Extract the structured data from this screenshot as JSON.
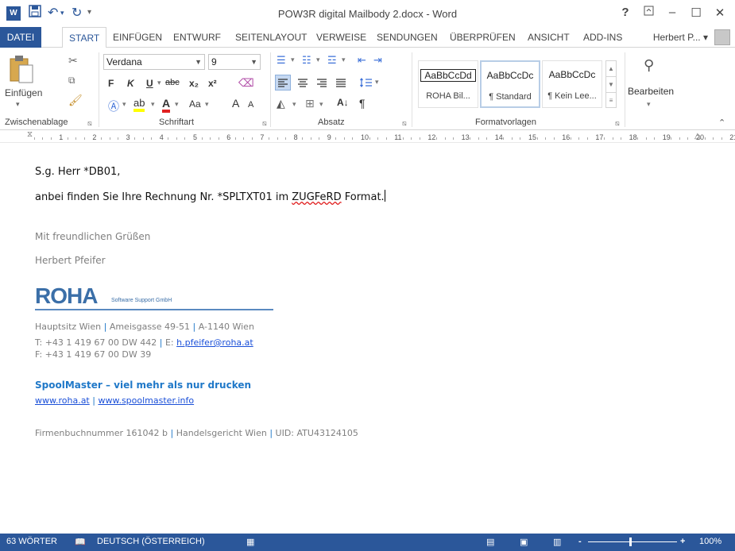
{
  "window": {
    "title": "POW3R digital Mailbody 2.docx - Word",
    "help": "?",
    "app_icon_letter": "W"
  },
  "tabs": {
    "file": "DATEI",
    "items": [
      "START",
      "EINFÜGEN",
      "ENTWURF",
      "SEITENLAYOUT",
      "VERWEISE",
      "SENDUNGEN",
      "ÜBERPRÜFEN",
      "ANSICHT",
      "ADD-INS"
    ],
    "active": "START",
    "user": "Herbert P... ▾"
  },
  "ribbon": {
    "clipboard": {
      "paste_label": "Einfügen",
      "group_label": "Zwischenablage"
    },
    "font": {
      "font_name": "Verdana",
      "font_size": "9",
      "bold": "F",
      "italic": "K",
      "underline": "U",
      "strike": "abc",
      "subscript": "x₂",
      "superscript": "x²",
      "grow": "A",
      "shrink": "A",
      "case": "Aa",
      "group_label": "Schriftart"
    },
    "paragraph": {
      "group_label": "Absatz",
      "pilcrow": "¶"
    },
    "styles": {
      "group_label": "Formatvorlagen",
      "items": [
        {
          "sample": "AaBbCcDd",
          "name": "ROHA Bil..."
        },
        {
          "sample": "AaBbCcDc",
          "name": "¶ Standard"
        },
        {
          "sample": "AaBbCcDc",
          "name": "¶ Kein Lee..."
        }
      ]
    },
    "editing": {
      "label": "Bearbeiten"
    }
  },
  "ruler": {
    "numbers": [
      "1",
      "2",
      "3",
      "4",
      "5",
      "6",
      "7",
      "8",
      "9",
      "10",
      "11",
      "12",
      "13",
      "14",
      "15",
      "16",
      "17",
      "18",
      "19",
      "20",
      "21"
    ]
  },
  "document": {
    "greeting": "S.g. Herr *DB01,",
    "body_before": "anbei finden Sie Ihre Rechnung Nr. *SPLTXT01 im ",
    "body_misspelled": "ZUGFeRD",
    "body_after": " Format.",
    "closing": "Mit freundlichen Grüßen",
    "signature": "Herbert Pfeifer",
    "logo": {
      "name": "ROHA",
      "sub": "Software Support GmbH"
    },
    "address": {
      "hq": "Hauptsitz Wien",
      "street": "Ameisgasse 49-51",
      "city": "A-1140 Wien"
    },
    "phone": "T: +43 1 419 67 00 DW 442",
    "email_label": "E: ",
    "email": "h.pfeifer@roha.at",
    "fax": "F: +43 1 419 67 00 DW 39",
    "slogan": "SpoolMaster – viel mehr als nur drucken",
    "website1": "www.roha.at",
    "website2": "www.spoolmaster.info",
    "registry": "Firmenbuchnummer 161042 b",
    "court": "Handelsgericht Wien",
    "uid": "UID: ATU43124105",
    "separator": "|"
  },
  "status": {
    "words": "63 WÖRTER",
    "language": "DEUTSCH (ÖSTERREICH)",
    "zoom": "100%",
    "zoom_minus": "-",
    "zoom_plus": "+"
  },
  "colors": {
    "accent": "#2b579a",
    "link": "#1a4fd8",
    "brand_blue": "#1f78c8"
  }
}
